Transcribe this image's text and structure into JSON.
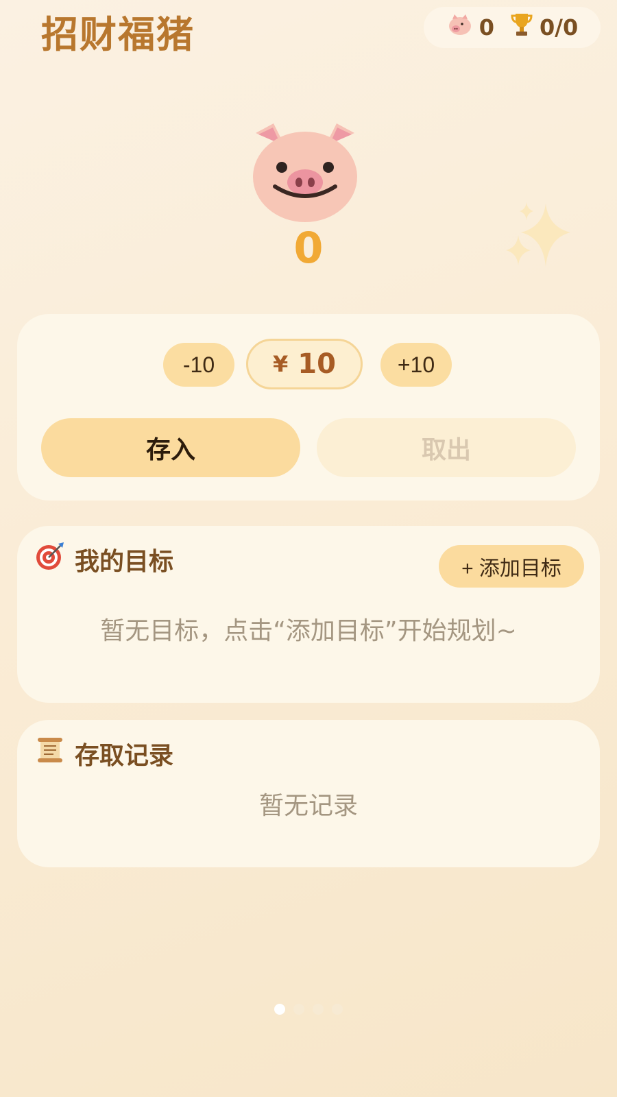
{
  "app": {
    "title": "招财福猪"
  },
  "stats": {
    "pig_count": "0",
    "trophy_progress": "0/0"
  },
  "balance": "0",
  "controls": {
    "minus_label": "-10",
    "currency_symbol": "¥",
    "amount": "10",
    "plus_label": "+10",
    "deposit_label": "存入",
    "withdraw_label": "取出"
  },
  "goals": {
    "icon": "target-icon",
    "title": "我的目标",
    "add_label": "+ 添加目标",
    "empty_text": "暂无目标，点击“添加目标”开始规划~"
  },
  "records": {
    "icon": "scroll-icon",
    "title": "存取记录",
    "empty_text": "暂无记录"
  },
  "pager": {
    "pages": 4,
    "active_index": 0
  },
  "colors": {
    "title": "#b8772e",
    "balance": "#f1a935",
    "button": "#fbdb9e",
    "card": "#fdf7e9",
    "muted_text": "#a49681"
  }
}
